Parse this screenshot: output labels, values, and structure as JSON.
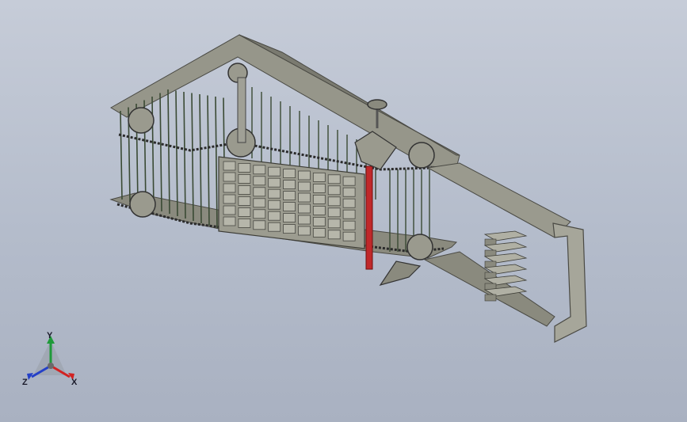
{
  "viewport": {
    "background_top": "#c6ccd8",
    "background_bottom": "#a9b1c1"
  },
  "model": {
    "frame_color": "#8e8e82",
    "frame_dark": "#6e6e64",
    "frame_light": "#a6a69a",
    "rod_color": "#3a4a34",
    "chain_color": "#2b2b2b",
    "highlight_color": "#c0282a",
    "grid_rows": 6,
    "grid_cols": 9,
    "tray_count": 6
  },
  "triad": {
    "x_label": "X",
    "y_label": "Y",
    "z_label": "Z",
    "x_color": "#d22222",
    "y_color": "#1f9a3a",
    "z_color": "#2440c8"
  }
}
